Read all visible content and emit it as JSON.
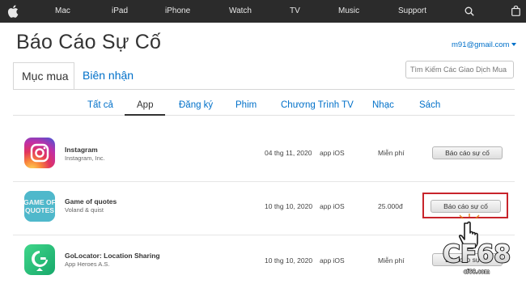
{
  "nav": {
    "items": [
      "Mac",
      "iPad",
      "iPhone",
      "Watch",
      "TV",
      "Music",
      "Support"
    ],
    "icons": [
      "apple-logo-icon",
      "search-icon",
      "shopping-bag-icon"
    ]
  },
  "header": {
    "title": "Báo Cáo Sự Cố",
    "account": "m91@gmail.com"
  },
  "tabs": {
    "purchases": "Mục mua",
    "receipts": "Biên nhận"
  },
  "search": {
    "placeholder": "Tìm Kiếm Các Giao Dịch Mua H"
  },
  "subtabs": [
    "Tất cả",
    "App",
    "Đăng ký",
    "Phim",
    "Chương Trình TV",
    "Nhạc",
    "Sách"
  ],
  "purchases": [
    {
      "name": "Instagram",
      "developer": "Instagram, Inc.",
      "date": "04 thg 11, 2020",
      "type": "app iOS",
      "price": "Miễn phí",
      "action": "Báo cáo sự cố",
      "icon": "instagram-icon"
    },
    {
      "name": "Game of quotes",
      "developer": "Voland & quist",
      "date": "10 thg 10, 2020",
      "type": "app iOS",
      "price": "25.000đ",
      "action": "Báo cáo sự cố",
      "icon": "game-of-quotes-icon",
      "icon_text": [
        "GAME OF",
        "QUOTES"
      ]
    },
    {
      "name": "GoLocator: Location Sharing",
      "developer": "App Heroes A.S.",
      "date": "10 thg 10, 2020",
      "type": "app iOS",
      "price": "Miễn phí",
      "action": "Báo cáo sự cố",
      "icon": "golocator-icon"
    }
  ],
  "watermark": {
    "text": "CF68",
    "sub": "cf68.com"
  },
  "colors": {
    "nav_bg": "#2b2b2b",
    "link": "#0070c9",
    "highlight": "#c8242b"
  }
}
